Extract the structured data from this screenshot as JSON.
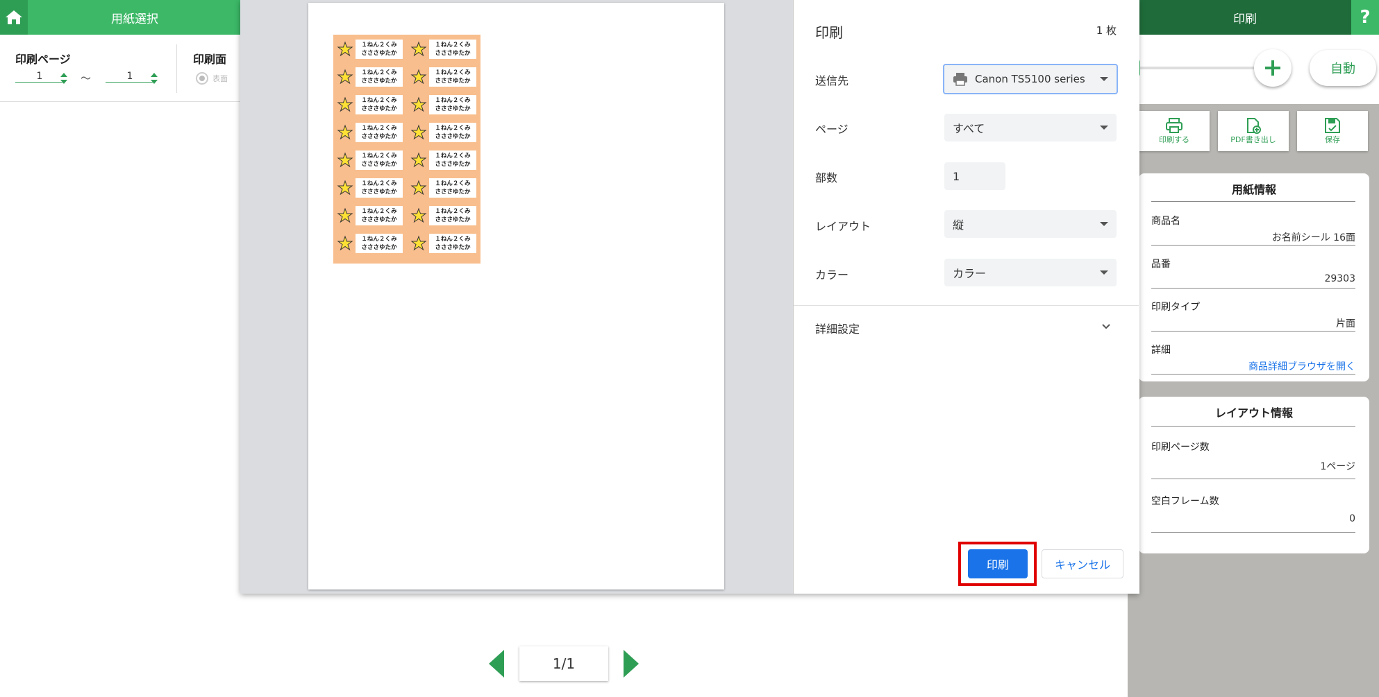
{
  "topbar": {
    "paper_tab": "用紙選択",
    "print_tab": "印刷",
    "help": "?"
  },
  "left_panel": {
    "print_pages_label": "印刷ページ",
    "page_from": "1",
    "tilde": "～",
    "page_to": "1",
    "print_side_label": "印刷面",
    "side_option": "表面"
  },
  "preview": {
    "label_line1": "１ねん２くみ",
    "label_line2": "さささゆたか",
    "label_count": 16
  },
  "print_dialog": {
    "title": "印刷",
    "sheet_count": "1 枚",
    "destination_label": "送信先",
    "destination_value": "Canon TS5100 series",
    "pages_label": "ページ",
    "pages_value": "すべて",
    "copies_label": "部数",
    "copies_value": "1",
    "layout_label": "レイアウト",
    "layout_value": "縦",
    "color_label": "カラー",
    "color_value": "カラー",
    "advanced_label": "詳細設定",
    "print_button": "印刷",
    "cancel_button": "キャンセル"
  },
  "right_panel": {
    "auto_button": "自動",
    "tools": [
      {
        "label": "印刷する",
        "icon": "printer-icon"
      },
      {
        "label": "PDF書き出し",
        "icon": "pdf-export-icon"
      },
      {
        "label": "保存",
        "icon": "save-icon"
      }
    ],
    "paper_info": {
      "title": "用紙情報",
      "product_name_label": "商品名",
      "product_name_value": "お名前シール 16面",
      "product_no_label": "品番",
      "product_no_value": "29303",
      "print_type_label": "印刷タイプ",
      "print_type_value": "片面",
      "detail_label": "詳細",
      "detail_link": "商品詳細ブラウザを開く"
    },
    "layout_info": {
      "title": "レイアウト情報",
      "page_count_label": "印刷ページ数",
      "page_count_value": "1ページ",
      "blank_frames_label": "空白フレーム数",
      "blank_frames_value": "0"
    }
  },
  "pager": {
    "current": "1/1"
  },
  "colors": {
    "brand_green": "#3cb867",
    "dark_green": "#1f6b3a",
    "print_blue": "#1a73e8",
    "highlight_red": "#e00000",
    "label_orange": "#f8be8d"
  }
}
